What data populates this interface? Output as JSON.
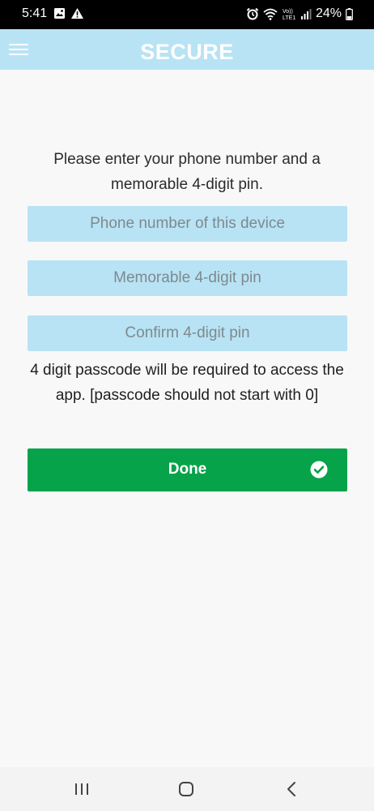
{
  "status_bar": {
    "time": "5:41",
    "battery_text": "24%",
    "icons": [
      "image-icon",
      "warning-icon",
      "alarm-icon",
      "wifi-icon",
      "volte-icon",
      "signal-icon",
      "battery-icon"
    ]
  },
  "app_bar": {
    "title": "SECURE",
    "menu_icon": "hamburger-menu-icon",
    "background_color": "#b8e3f4"
  },
  "form": {
    "instruction": "Please enter your phone number and a memorable 4-digit pin.",
    "phone_placeholder": "Phone number of this device",
    "pin_placeholder": "Memorable 4-digit pin",
    "confirm_placeholder": "Confirm 4-digit pin",
    "note": "4 digit passcode will be required to access the app. [passcode should not start with 0]",
    "done_label": "Done",
    "done_icon": "check-circle-icon",
    "done_color": "#06a34a"
  },
  "nav_bar": {
    "icons": [
      "recents-icon",
      "home-icon",
      "back-icon"
    ]
  }
}
